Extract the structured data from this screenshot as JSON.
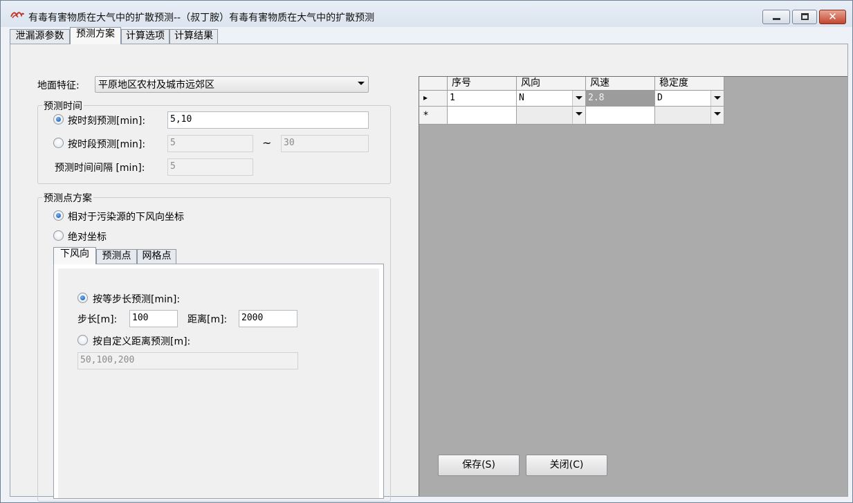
{
  "window": {
    "title": "有毒有害物质在大气中的扩散预测--（叔丁胺）有毒有害物质在大气中的扩散预测",
    "close_glyph": "✕"
  },
  "tabs": [
    {
      "label": "泄漏源参数"
    },
    {
      "label": "预测方案"
    },
    {
      "label": "计算选项"
    },
    {
      "label": "计算结果"
    }
  ],
  "active_tab": "预测方案",
  "terrain": {
    "label": "地面特征:",
    "selected": "平原地区农村及城市远郊区"
  },
  "predict_time": {
    "group_title": "预测时间",
    "by_moment_label": "按时刻预测[min]:",
    "by_moment_value": "5,10",
    "by_moment_checked": true,
    "by_period_label": "按时段预测[min]:",
    "by_period_from": "5",
    "tilde": "~",
    "by_period_to": "30",
    "interval_label": "预测时间间隔 [min]:",
    "interval_value": "5"
  },
  "predict_points": {
    "group_title": "预测点方案",
    "relative_label": "相对于污染源的下风向坐标",
    "relative_checked": true,
    "absolute_label": "绝对坐标",
    "subtabs": [
      {
        "label": "下风向"
      },
      {
        "label": "预测点"
      },
      {
        "label": "网格点"
      }
    ],
    "equal_step_label": "按等步长预测[min]:",
    "step_label": "步长[m]:",
    "step_value": "100",
    "distance_label": "距离[m]:",
    "distance_value": "2000",
    "custom_label": "按自定义距离预测[m]:",
    "custom_value": "50,100,200"
  },
  "grid": {
    "columns": [
      "序号",
      "风向",
      "风速",
      "稳定度"
    ],
    "rows": [
      {
        "marker": "▸",
        "index": "1",
        "direction": "N",
        "speed": "2.8",
        "stability": "D"
      },
      {
        "marker": "*",
        "index": "",
        "direction": "",
        "speed": "",
        "stability": ""
      }
    ]
  },
  "buttons": {
    "save": "保存(S)",
    "close": "关闭(C)"
  }
}
